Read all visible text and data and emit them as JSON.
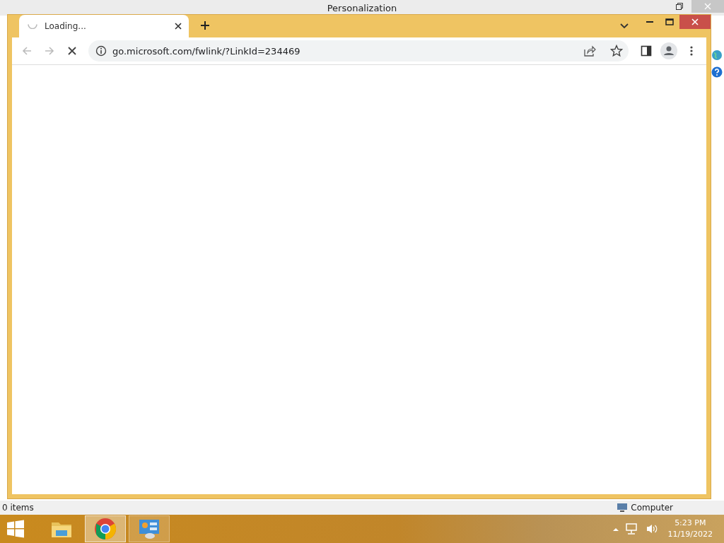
{
  "background_window": {
    "title": "Personalization",
    "status_left": "0 items",
    "status_right": "Computer"
  },
  "browser": {
    "tabs": [
      {
        "title": "Loading...",
        "loading": true,
        "selected": true
      }
    ],
    "nav": [
      {
        "kind": "back",
        "disabled": true
      },
      {
        "kind": "forward",
        "disabled": true
      },
      {
        "kind": "stop",
        "disabled": false
      }
    ],
    "address": {
      "value": "go.microsoft.com/fwlink/?LinkId=234469"
    }
  },
  "taskbar": {
    "apps": [
      {
        "kind": "explorer",
        "selected": false,
        "running": false
      },
      {
        "kind": "chrome",
        "selected": true,
        "running": true
      },
      {
        "kind": "control-panel",
        "selected": false,
        "running": true
      }
    ],
    "time": "5:23 PM",
    "date": "11/19/2022"
  }
}
